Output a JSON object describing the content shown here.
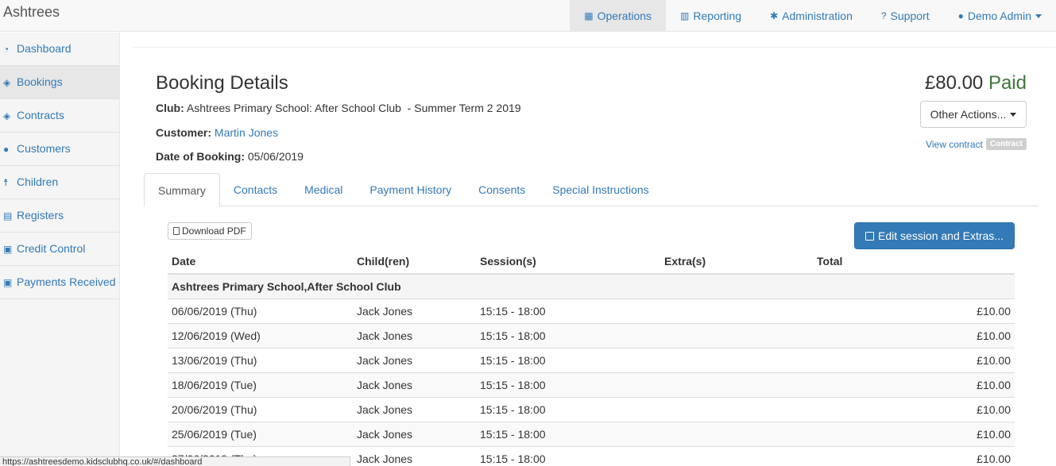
{
  "app": {
    "brand": "Ashtrees"
  },
  "nav": {
    "operations": "Operations",
    "reporting": "Reporting",
    "administration": "Administration",
    "support": "Support",
    "user": "Demo Admin"
  },
  "sidebar": {
    "items": [
      {
        "label": "Dashboard",
        "icon": "dashboard-icon"
      },
      {
        "label": "Bookings",
        "icon": "ticket-icon"
      },
      {
        "label": "Contracts",
        "icon": "ticket-icon"
      },
      {
        "label": "Customers",
        "icon": "users-icon"
      },
      {
        "label": "Children",
        "icon": "child-icon"
      },
      {
        "label": "Registers",
        "icon": "table-icon"
      },
      {
        "label": "Credit Control",
        "icon": "money-icon"
      },
      {
        "label": "Payments Received",
        "icon": "money-icon"
      }
    ]
  },
  "booking": {
    "title": "Booking Details",
    "club_label": "Club:",
    "club_value": "Ashtrees Primary School: After School Club  - Summer Term 2 2019",
    "customer_label": "Customer:",
    "customer_value": "Martin Jones",
    "date_label": "Date of Booking:",
    "date_value": "05/06/2019",
    "price": "£80.00",
    "status": "Paid",
    "other_actions": "Other Actions...",
    "view_contract": "View contract",
    "contract_badge": "Contract"
  },
  "tabs": [
    "Summary",
    "Contacts",
    "Medical",
    "Payment History",
    "Consents",
    "Special Instructions"
  ],
  "toolbar": {
    "download_pdf": "Download PDF",
    "edit_session": "Edit session and Extras..."
  },
  "table": {
    "headers": [
      "Date",
      "Child(ren)",
      "Session(s)",
      "Extra(s)",
      "Total"
    ],
    "group": "Ashtrees Primary School,After School Club",
    "rows": [
      {
        "date": "06/06/2019 (Thu)",
        "child": "Jack Jones",
        "session": "15:15 - 18:00",
        "extras": "",
        "total": "£10.00"
      },
      {
        "date": "12/06/2019 (Wed)",
        "child": "Jack Jones",
        "session": "15:15 - 18:00",
        "extras": "",
        "total": "£10.00"
      },
      {
        "date": "13/06/2019 (Thu)",
        "child": "Jack Jones",
        "session": "15:15 - 18:00",
        "extras": "",
        "total": "£10.00"
      },
      {
        "date": "18/06/2019 (Tue)",
        "child": "Jack Jones",
        "session": "15:15 - 18:00",
        "extras": "",
        "total": "£10.00"
      },
      {
        "date": "20/06/2019 (Thu)",
        "child": "Jack Jones",
        "session": "15:15 - 18:00",
        "extras": "",
        "total": "£10.00"
      },
      {
        "date": "25/06/2019 (Tue)",
        "child": "Jack Jones",
        "session": "15:15 - 18:00",
        "extras": "",
        "total": "£10.00"
      },
      {
        "date": "27/06/2019 (Thu)",
        "child": "Jack Jones",
        "session": "15:15 - 18:00",
        "extras": "",
        "total": "£10.00"
      }
    ]
  },
  "statusbar": {
    "url": "https://ashtreesdemo.kidsclubhq.co.uk/#/dashboard"
  },
  "colors": {
    "link": "#337ab7",
    "paid": "#3c763d",
    "primary_button": "#337ab7"
  }
}
